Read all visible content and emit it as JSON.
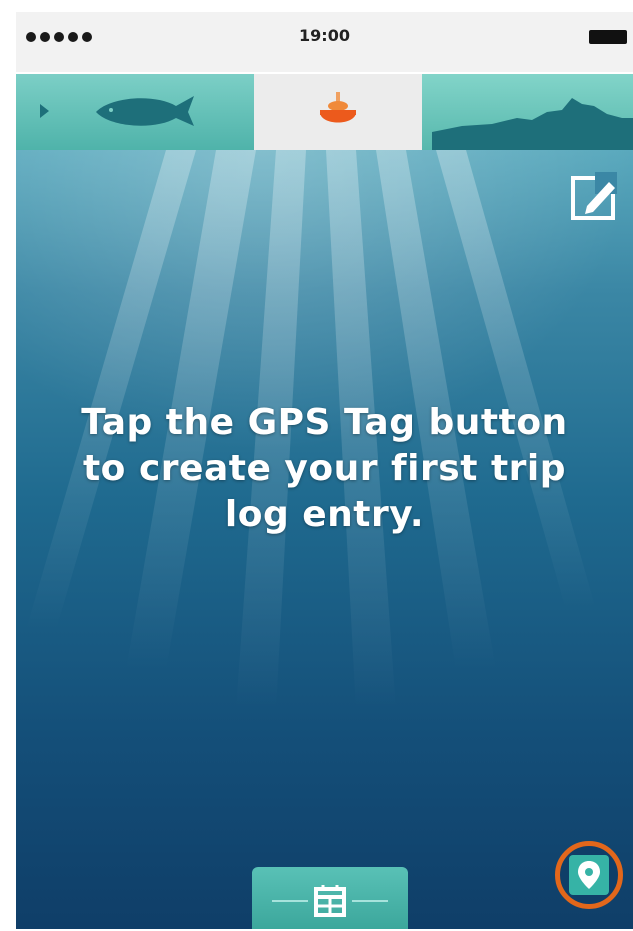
{
  "status_bar": {
    "time": "19:00"
  },
  "tabs": [
    {
      "icon": "fish-icon"
    },
    {
      "icon": "bobber-icon"
    },
    {
      "icon": "terrain-icon"
    }
  ],
  "main": {
    "message": "Tap the GPS Tag button to create your first trip log entry."
  },
  "colors": {
    "accent": "#36b3a6",
    "highlight_ring": "#e2671b",
    "bobber": "#ec5a1c"
  }
}
